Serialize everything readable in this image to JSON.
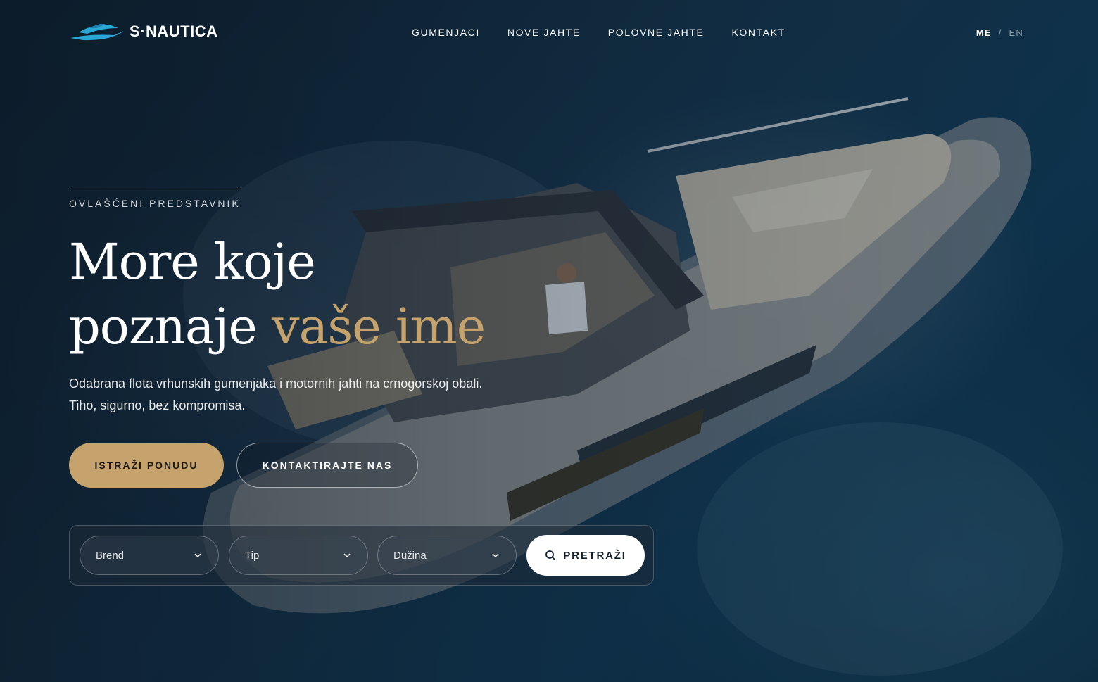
{
  "brand": {
    "name": "S·NAUTICA",
    "accent": "#29a8d8"
  },
  "nav": {
    "items": [
      {
        "label": "GUMENJACI"
      },
      {
        "label": "NOVE JAHTE"
      },
      {
        "label": "POLOVNE JAHTE"
      },
      {
        "label": "KONTAKT"
      }
    ]
  },
  "lang": {
    "active": "ME",
    "separator": "/",
    "other": "EN"
  },
  "hero": {
    "eyebrow": "OVLAŠĆENI PREDSTAVNIK",
    "title_line1": "More koje",
    "title_line2_start": "poznaje",
    "title_line2_highlight": "vaše ime",
    "lead": "Odabrana flota vrhunskih gumenjaka i motornih jahti na crnogorskoj obali. Tiho, sigurno, bez kompromisa.",
    "primary_cta": "ISTRAŽI PONUDU",
    "secondary_cta": "KONTAKTIRAJTE NAS",
    "accent_color": "#c6a36c"
  },
  "search": {
    "brand_select": "Brend",
    "type_select": "Tip",
    "length_select": "Dužina",
    "button": "PRETRAŽI",
    "icon": "search-icon"
  }
}
